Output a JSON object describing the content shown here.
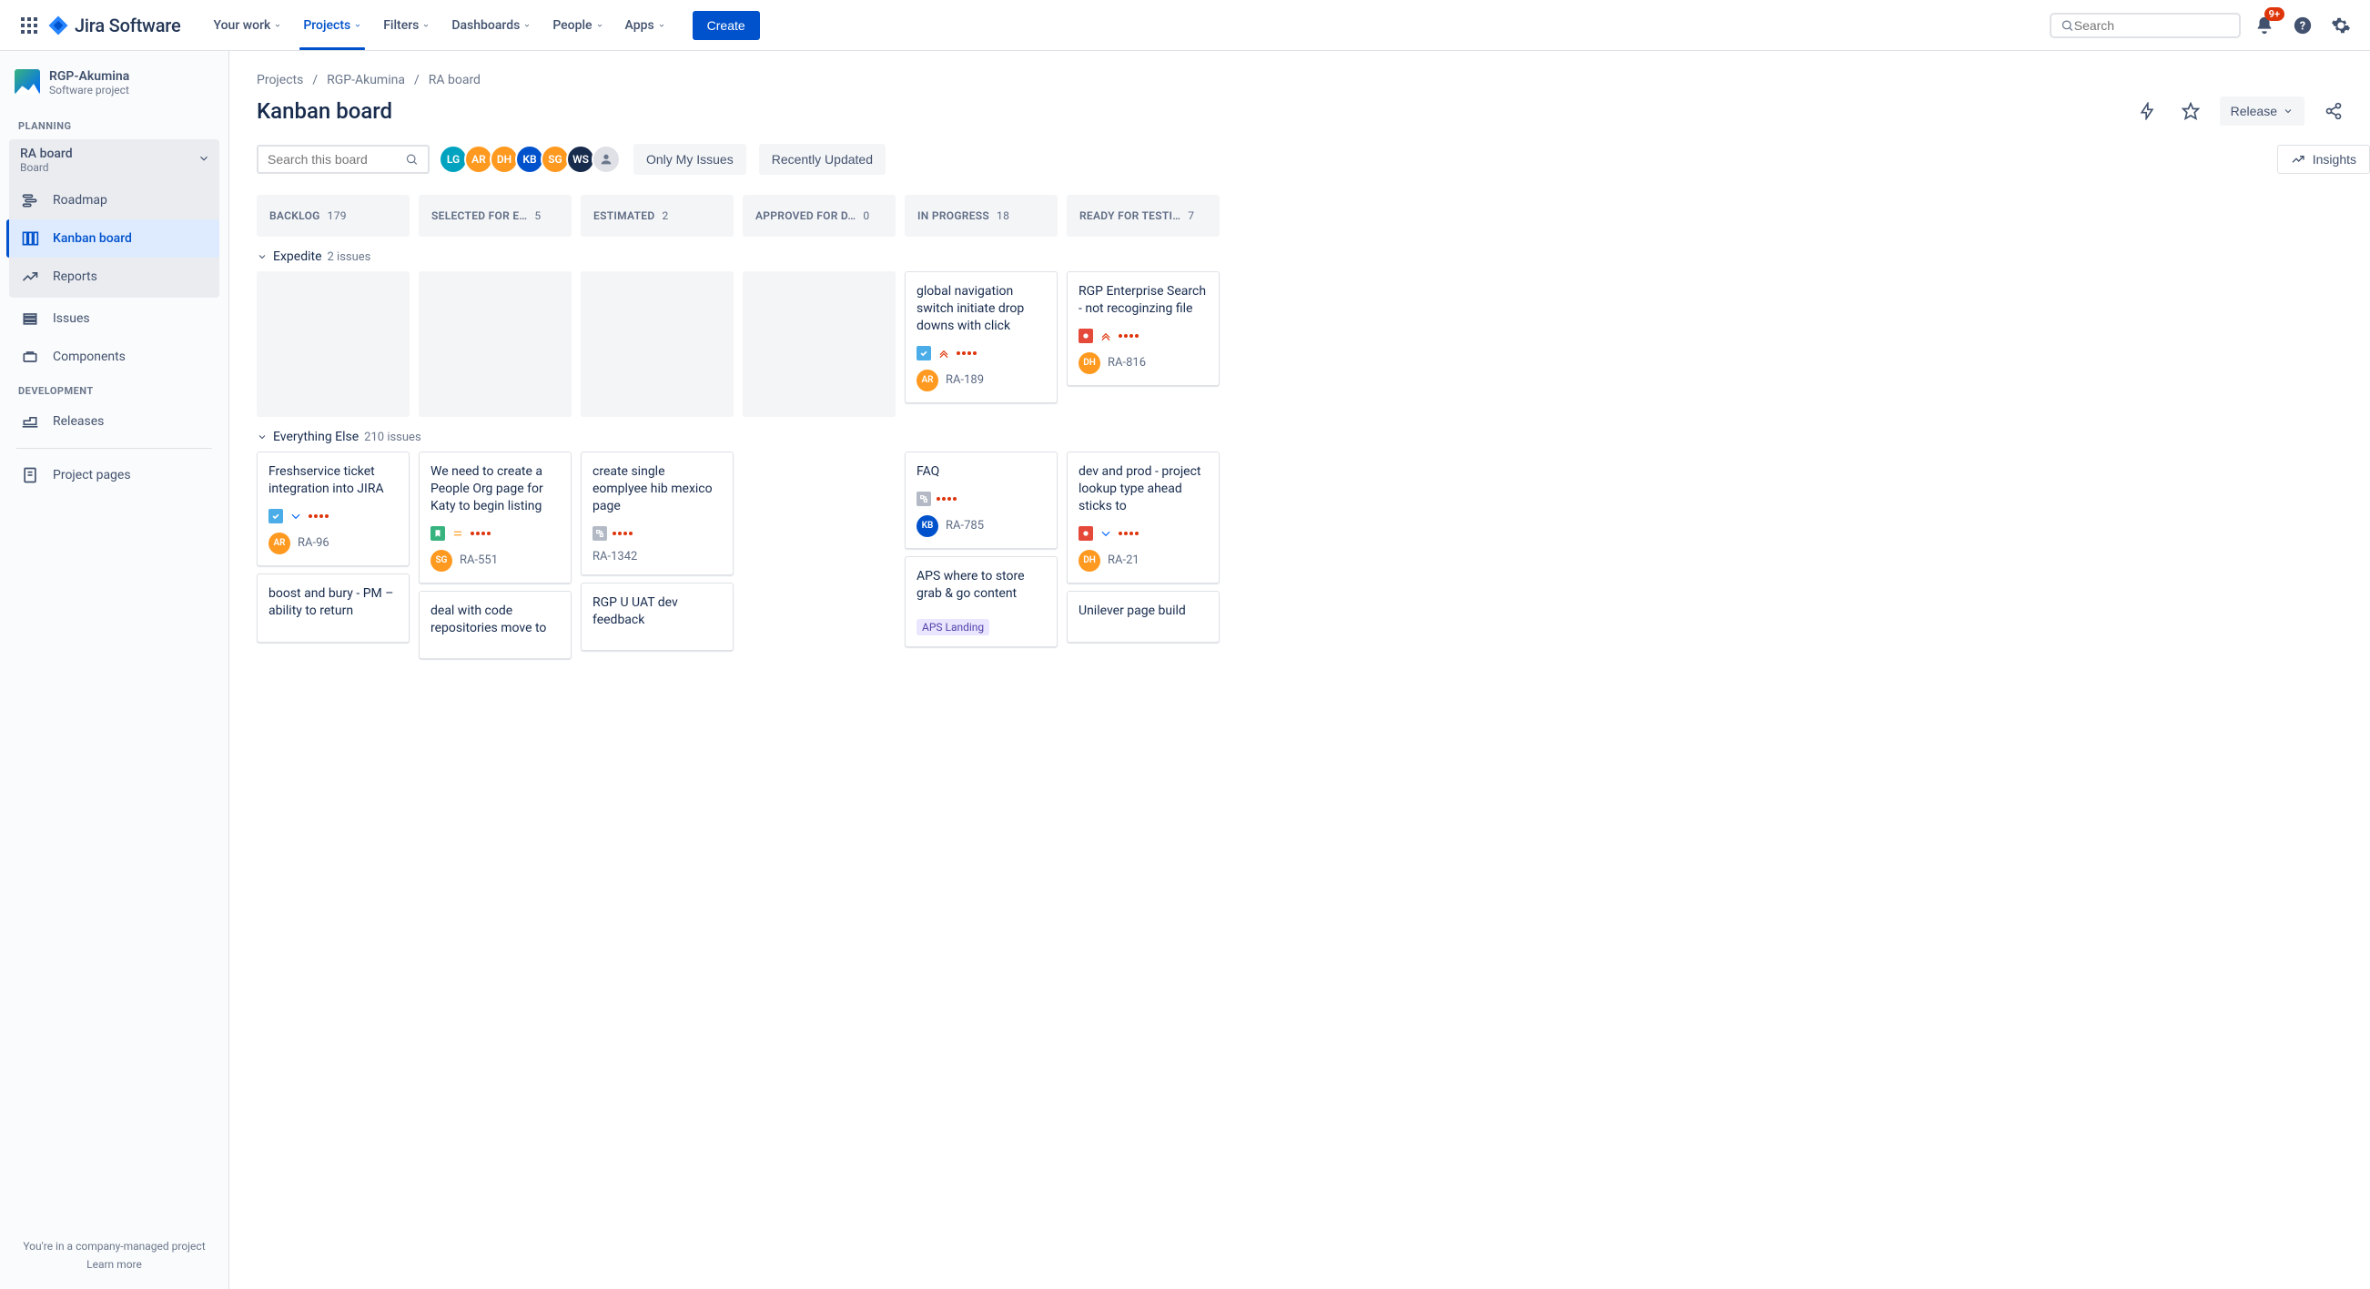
{
  "nav": {
    "logo": "Jira Software",
    "items": [
      "Your work",
      "Projects",
      "Filters",
      "Dashboards",
      "People",
      "Apps"
    ],
    "active_index": 1,
    "create": "Create",
    "search_placeholder": "Search",
    "notif_badge": "9+"
  },
  "sidebar": {
    "project_name": "RGP-Akumina",
    "project_type": "Software project",
    "sections": {
      "planning": "PLANNING",
      "development": "DEVELOPMENT"
    },
    "board_expand": {
      "title": "RA board",
      "subtitle": "Board"
    },
    "items": {
      "roadmap": "Roadmap",
      "kanban": "Kanban board",
      "reports": "Reports",
      "issues": "Issues",
      "components": "Components",
      "releases": "Releases",
      "project_pages": "Project pages"
    },
    "footer_line": "You're in a company-managed project",
    "footer_link": "Learn more"
  },
  "breadcrumb": [
    "Projects",
    "RGP-Akumina",
    "RA board"
  ],
  "page": {
    "title": "Kanban board",
    "release": "Release",
    "insights": "Insights",
    "board_search_placeholder": "Search this board",
    "only_my": "Only My Issues",
    "recent": "Recently Updated"
  },
  "avatars": [
    {
      "initials": "LG",
      "cls": "av-lg"
    },
    {
      "initials": "AR",
      "cls": "av-ar"
    },
    {
      "initials": "DH",
      "cls": "av-dh"
    },
    {
      "initials": "KB",
      "cls": "av-kb"
    },
    {
      "initials": "SG",
      "cls": "av-sg"
    },
    {
      "initials": "WS",
      "cls": "av-ws"
    }
  ],
  "columns": [
    {
      "name": "BACKLOG",
      "count": "179"
    },
    {
      "name": "SELECTED FOR E…",
      "count": "5"
    },
    {
      "name": "ESTIMATED",
      "count": "2"
    },
    {
      "name": "APPROVED FOR D…",
      "count": "0"
    },
    {
      "name": "IN PROGRESS",
      "count": "18"
    },
    {
      "name": "READY FOR TESTI…",
      "count": "7"
    }
  ],
  "swimlanes": {
    "expedite": {
      "name": "Expedite",
      "count": "2 issues"
    },
    "else": {
      "name": "Everything Else",
      "count": "210 issues"
    }
  },
  "cards": {
    "exp_inprogress": {
      "title": "global navigation switch initiate drop downs with click",
      "type": "task",
      "prio": "highest",
      "dots": "red",
      "assignee": {
        "i": "AR",
        "cls": "av-ar"
      },
      "key": "RA-189"
    },
    "exp_ready": {
      "title": "RGP Enterprise Search - not recoginzing file",
      "type": "bug",
      "prio": "highest",
      "dots": "red",
      "assignee": {
        "i": "DH",
        "cls": "av-dh"
      },
      "key": "RA-816"
    },
    "backlog1": {
      "title": "Freshservice ticket integration into JIRA",
      "type": "task",
      "prio": "low",
      "dots": "red",
      "assignee": {
        "i": "AR",
        "cls": "av-ar"
      },
      "key": "RA-96"
    },
    "backlog2": {
      "title": "boost and bury - PM – ability to return"
    },
    "sel1": {
      "title": "We need to create a People Org page for Katy to begin listing",
      "type": "story",
      "prio": "medium",
      "dots": "red",
      "assignee": {
        "i": "SG",
        "cls": "av-sg"
      },
      "key": "RA-551"
    },
    "sel2": {
      "title": "deal with code repositories move to"
    },
    "est1": {
      "title": "create single eomplyee hib mexico page",
      "type": "sub",
      "dots": "red",
      "key": "RA-1342"
    },
    "est2": {
      "title": "RGP U UAT dev feedback"
    },
    "ip1": {
      "title": "FAQ",
      "type": "sub",
      "dots": "red",
      "assignee": {
        "i": "KB",
        "cls": "av-kb"
      },
      "key": "RA-785"
    },
    "ip2": {
      "title": "APS where to store grab & go content",
      "tag": "APS Landing"
    },
    "ready1": {
      "title": "dev and prod - project lookup type ahead sticks to",
      "type": "bug",
      "prio": "low",
      "dots": "red",
      "assignee": {
        "i": "DH",
        "cls": "av-dh"
      },
      "key": "RA-21"
    },
    "ready2": {
      "title": "Unilever page build"
    }
  }
}
